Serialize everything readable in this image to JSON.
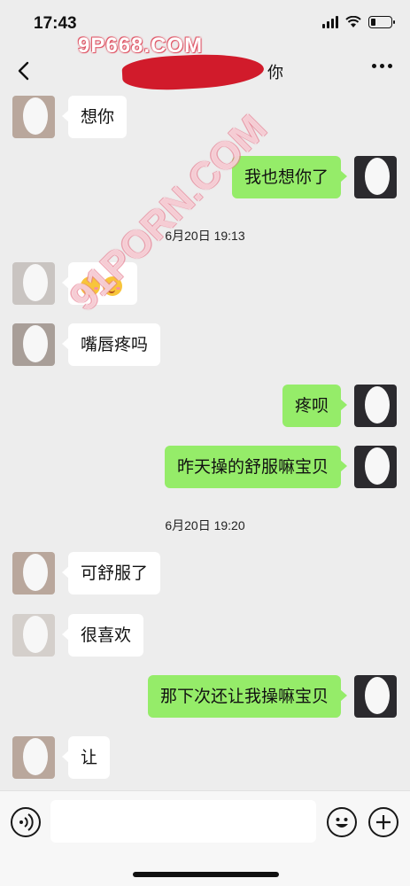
{
  "status_bar": {
    "time": "17:43",
    "battery_level": 0.25
  },
  "nav": {
    "title_visible": "你"
  },
  "watermarks": {
    "top": "9P668.COM",
    "diagonal": "91PORN.COM"
  },
  "messages": [
    {
      "side": "in",
      "text": "想你"
    },
    {
      "side": "out",
      "text": "我也想你了"
    },
    {
      "type": "time",
      "text": "6月20日 19:13"
    },
    {
      "side": "in",
      "type": "emoji",
      "emoji": [
        "kissing-face-emoji",
        "kissing-face-emoji"
      ]
    },
    {
      "side": "in",
      "text": "嘴唇疼吗"
    },
    {
      "side": "out",
      "text": "疼呗"
    },
    {
      "side": "out",
      "text": "昨天操的舒服嘛宝贝"
    },
    {
      "type": "time",
      "text": "6月20日 19:20"
    },
    {
      "side": "in",
      "text": "可舒服了"
    },
    {
      "side": "in",
      "text": "很喜欢"
    },
    {
      "side": "out",
      "text": "那下次还让我操嘛宝贝"
    },
    {
      "side": "in",
      "text": "让"
    }
  ],
  "colors": {
    "outgoing_bubble": "#95ec69",
    "incoming_bubble": "#ffffff",
    "background": "#ededed",
    "title_mask": "#d11b2b"
  },
  "icons": {
    "back": "chevron-left-icon",
    "more": "more-dots-icon",
    "voice": "voice-icon",
    "emoji": "emoji-icon",
    "plus": "plus-icon"
  }
}
